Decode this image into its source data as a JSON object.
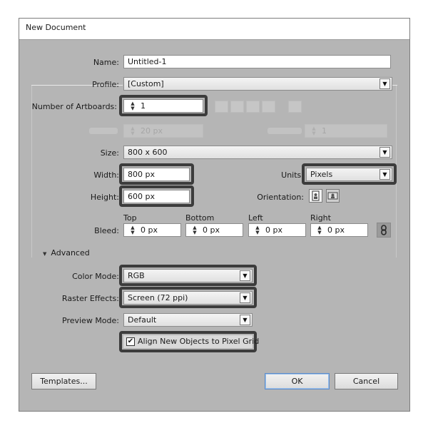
{
  "title": "New Document",
  "name": {
    "label": "Name:",
    "value": "Untitled-1"
  },
  "profile": {
    "label": "Profile:",
    "value": "[Custom]"
  },
  "artboards": {
    "label": "Number of Artboards:",
    "value": "1"
  },
  "spacing": {
    "value": "20 px"
  },
  "columns": {
    "value": "1"
  },
  "size": {
    "label": "Size:",
    "value": "800 x 600"
  },
  "width": {
    "label": "Width:",
    "value": "800 px"
  },
  "height": {
    "label": "Height:",
    "value": "600 px"
  },
  "units": {
    "label": "Units:",
    "value": "Pixels"
  },
  "orientation": {
    "label": "Orientation:"
  },
  "bleed": {
    "label": "Bleed:",
    "top": {
      "label": "Top",
      "value": "0 px"
    },
    "bottom": {
      "label": "Bottom",
      "value": "0 px"
    },
    "left": {
      "label": "Left",
      "value": "0 px"
    },
    "right": {
      "label": "Right",
      "value": "0 px"
    }
  },
  "advanced": {
    "label": "Advanced"
  },
  "color_mode": {
    "label": "Color Mode:",
    "value": "RGB"
  },
  "raster_effects": {
    "label": "Raster Effects:",
    "value": "Screen (72 ppi)"
  },
  "preview_mode": {
    "label": "Preview Mode:",
    "value": "Default"
  },
  "align_grid": {
    "label": "Align New Objects to Pixel Grid",
    "checked": true
  },
  "buttons": {
    "templates": "Templates...",
    "ok": "OK",
    "cancel": "Cancel"
  },
  "icons": {
    "spinner": "spinner-arrows-icon",
    "dropdown": "chevron-down-icon",
    "portrait": "portrait-orientation-icon",
    "landscape": "landscape-orientation-icon",
    "link": "chain-link-icon",
    "disclosure": "triangle-down-icon",
    "check": "checkmark-icon"
  },
  "colors": {
    "dialog_bg": "#b5b5b5",
    "highlight": "#3c3c3c",
    "default_button_border": "#5d8cc9"
  }
}
